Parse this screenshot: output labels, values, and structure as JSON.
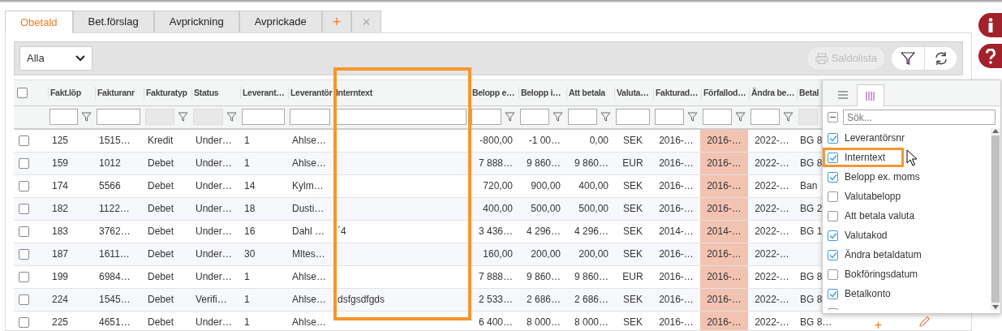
{
  "tabs": [
    {
      "label": "Obetald",
      "selected": true
    },
    {
      "label": "Bet.förslag",
      "selected": false
    },
    {
      "label": "Avprickning",
      "selected": false
    },
    {
      "label": "Avprickade",
      "selected": false
    }
  ],
  "tab_actions": [
    "+",
    "×"
  ],
  "toolbar": {
    "filter_select": {
      "value": "Alla"
    },
    "print_button": {
      "label": "Saldolista",
      "disabled": true
    }
  },
  "table": {
    "all_checked": false
  },
  "columns": [
    {
      "label": "Fakt.löp",
      "kind": "text",
      "filter": {
        "disabled": false,
        "icon": true
      },
      "highlighted": false,
      "shaded": false
    },
    {
      "label": "Fakturanr",
      "kind": "text",
      "filter": {
        "disabled": false,
        "icon": false
      },
      "highlighted": false,
      "shaded": false
    },
    {
      "label": "Fakturatyp",
      "kind": "text",
      "filter": {
        "disabled": true,
        "icon": true
      },
      "highlighted": false,
      "shaded": false
    },
    {
      "label": "Status",
      "kind": "text",
      "filter": {
        "disabled": true,
        "icon": true
      },
      "highlighted": false,
      "shaded": false
    },
    {
      "label": "Leverant…",
      "kind": "text",
      "filter": {
        "disabled": false,
        "icon": false
      },
      "highlighted": false,
      "shaded": false
    },
    {
      "label": "Leverantör",
      "kind": "text",
      "filter": {
        "disabled": false,
        "icon": false
      },
      "highlighted": false,
      "shaded": false
    },
    {
      "label": "Interntext",
      "kind": "text",
      "filter": {
        "disabled": false,
        "icon": false
      },
      "highlighted": true,
      "shaded": false
    },
    {
      "label": "Belopp e…",
      "kind": "amount",
      "filter": {
        "disabled": false,
        "icon": true
      },
      "highlighted": false,
      "shaded": false
    },
    {
      "label": "Belopp i…",
      "kind": "amount",
      "filter": {
        "disabled": false,
        "icon": true
      },
      "highlighted": false,
      "shaded": false
    },
    {
      "label": "Att betala",
      "kind": "amount",
      "filter": {
        "disabled": false,
        "icon": true
      },
      "highlighted": false,
      "shaded": false
    },
    {
      "label": "Valuta…",
      "kind": "code",
      "filter": {
        "disabled": false,
        "icon": false
      },
      "highlighted": false,
      "shaded": false
    },
    {
      "label": "Fakturad…",
      "kind": "code",
      "filter": {
        "disabled": false,
        "icon": true
      },
      "highlighted": false,
      "shaded": false
    },
    {
      "label": "Förfallod…",
      "kind": "code",
      "filter": {
        "disabled": false,
        "icon": true
      },
      "highlighted": false,
      "shaded": true
    },
    {
      "label": "Ändra be…",
      "kind": "code",
      "filter": {
        "disabled": false,
        "icon": true
      },
      "highlighted": false,
      "shaded": false
    },
    {
      "label": "Betal",
      "kind": "text",
      "filter": {
        "disabled": true,
        "icon": false
      },
      "highlighted": false,
      "shaded": false
    }
  ],
  "rows": [
    {
      "checked": false,
      "cells": [
        "125",
        "1515…",
        "Kredit",
        "Under…",
        "1",
        "Ahlse…",
        null,
        "-800,00",
        "-1 00…",
        "0,00",
        "SEK",
        "2016-…",
        "2016-…",
        "2022-…",
        "BG 8"
      ]
    },
    {
      "checked": false,
      "cells": [
        "159",
        "1012",
        "Debet",
        "Under…",
        "1",
        "Ahlse…",
        null,
        "7 888…",
        "9 860…",
        "9 860…",
        "EUR",
        "2016-…",
        "2016-…",
        "2022-…",
        "BG 8"
      ]
    },
    {
      "checked": false,
      "cells": [
        "174",
        "5566",
        "Debet",
        "Under…",
        "14",
        "Kylm…",
        null,
        "720,00",
        "900,00",
        "400,00",
        "SEK",
        "2016-…",
        "2016-…",
        "2022-…",
        "Ban"
      ]
    },
    {
      "checked": false,
      "cells": [
        "182",
        "1122…",
        "Debet",
        "Under…",
        "18",
        "Dusti…",
        null,
        "400,00",
        "500,00",
        "500,00",
        "SEK",
        "2016-…",
        "2016-…",
        "2022-…",
        "BG 2"
      ]
    },
    {
      "checked": false,
      "cells": [
        "183",
        "3762…",
        "Debet",
        "Under…",
        "16",
        "Dahl …",
        "´4",
        "3 436…",
        "4 296…",
        "4 296…",
        "SEK",
        "2014-…",
        "2014-…",
        "2022-…",
        "BG 1"
      ]
    },
    {
      "checked": false,
      "cells": [
        "187",
        "1611…",
        "Debet",
        "Under…",
        "30",
        "Mltes…",
        null,
        "160,00",
        "200,00",
        "200,00",
        "SEK",
        "2016-…",
        "2016-…",
        "2022-…",
        null
      ]
    },
    {
      "checked": false,
      "cells": [
        "199",
        "6984…",
        "Debet",
        "Under…",
        "1",
        "Ahlse…",
        null,
        "7 888…",
        "9 860…",
        "9 860…",
        "EUR",
        "2016-…",
        "2016-…",
        "2022-…",
        "BG 8"
      ]
    },
    {
      "checked": false,
      "cells": [
        "224",
        "1545…",
        "Debet",
        "Verifi…",
        "1",
        "Ahlse…",
        "dsfgsdfgds",
        "2 533…",
        "2 686…",
        "2 686…",
        "SEK",
        "2016-…",
        "2016-…",
        "2022-…",
        "BG 8"
      ]
    },
    {
      "checked": false,
      "cells": [
        "225",
        "4651…",
        "Debet",
        "Under…",
        "1",
        "Ahlse…",
        null,
        "6 400…",
        "8 000…",
        "8 000…",
        "SEK",
        "2016-…",
        "2016-…",
        "2022-…",
        "BG 8…"
      ],
      "action": "+",
      "editable": true
    }
  ],
  "column_chooser": {
    "tabs": [
      {
        "kind": "menu",
        "selected": false
      },
      {
        "kind": "columns",
        "selected": true
      }
    ],
    "select_all_indeterminate": true,
    "search": {
      "placeholder": "Sök..."
    },
    "items": [
      {
        "label": "Leverantörsnr",
        "checked": true,
        "highlighted": false
      },
      {
        "label": "Interntext",
        "checked": true,
        "highlighted": true
      },
      {
        "label": "Belopp ex. moms",
        "checked": true,
        "highlighted": false
      },
      {
        "label": "Valutabelopp",
        "checked": false,
        "highlighted": false
      },
      {
        "label": "Att betala valuta",
        "checked": false,
        "highlighted": false
      },
      {
        "label": "Valutakod",
        "checked": true,
        "highlighted": false
      },
      {
        "label": "Ändra betaldatum",
        "checked": true,
        "highlighted": false
      },
      {
        "label": "Bokföringsdatum",
        "checked": false,
        "highlighted": false
      },
      {
        "label": "Betalkonto",
        "checked": true,
        "highlighted": false
      },
      {
        "checked": false,
        "highlighted": false
      }
    ]
  },
  "side_buttons": [
    {
      "kind": "info"
    },
    {
      "kind": "help"
    }
  ]
}
